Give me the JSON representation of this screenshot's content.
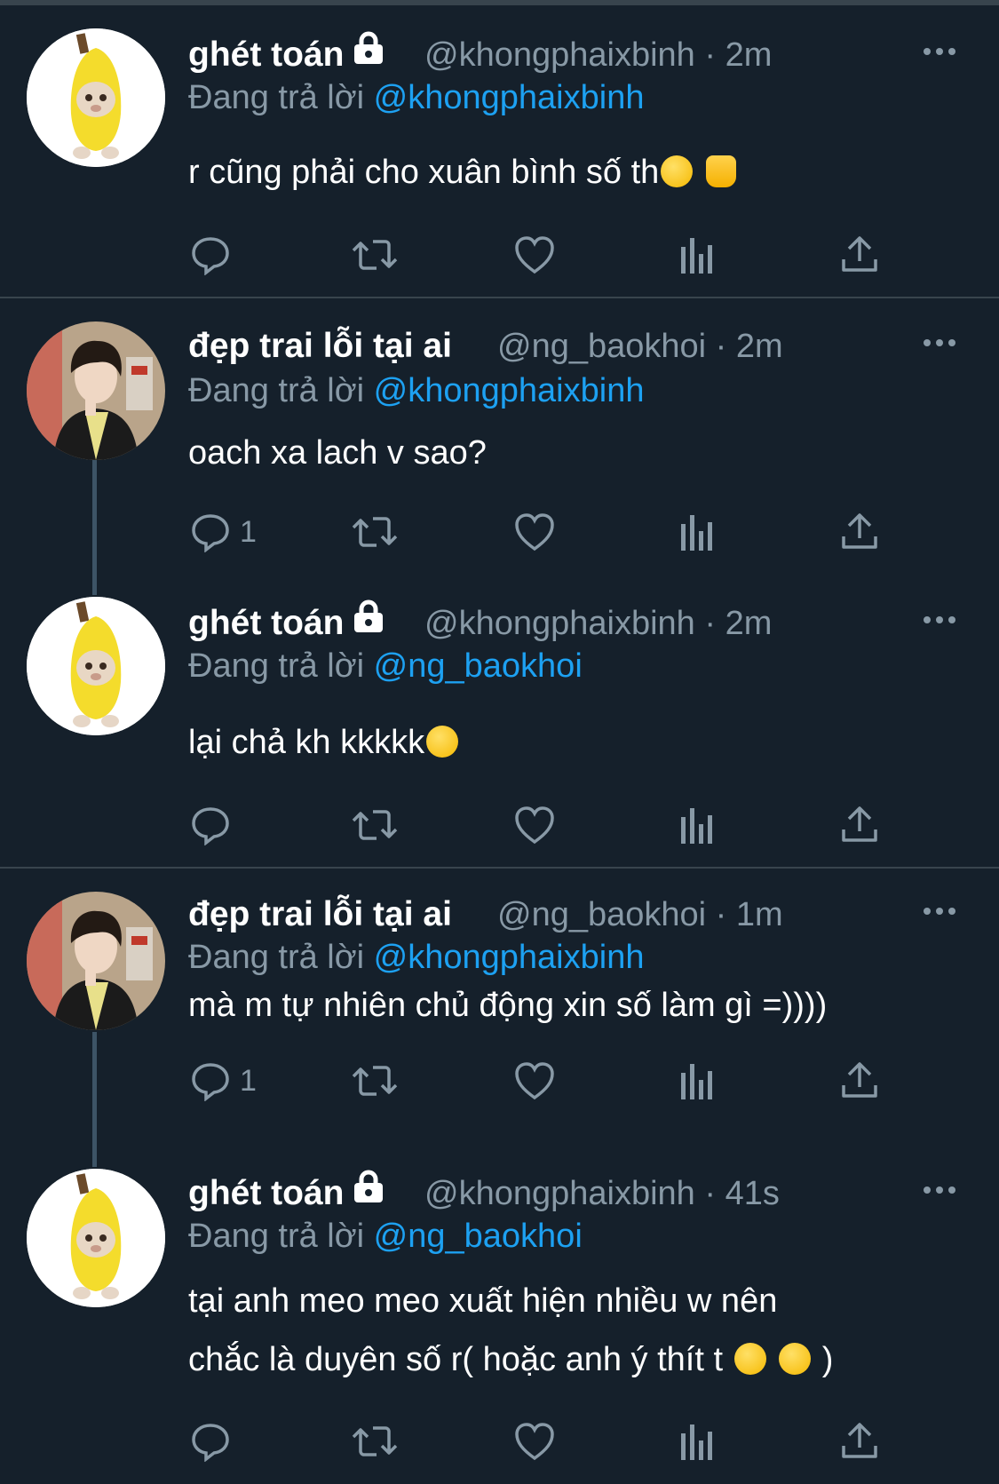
{
  "tweets": [
    {
      "display_name": "ghét toán",
      "locked": true,
      "handle": "@khongphaixbinh",
      "time": "2m",
      "replying_label": "Đang trả lời",
      "replying_to": "@khongphaixbinh",
      "text": "r cũng phải cho xuân bình số th",
      "emojis": [
        "grinning-face-emoji",
        "thumbs-up-emoji"
      ],
      "reply_count": ""
    },
    {
      "display_name": "đẹp trai lỗi tại ai",
      "locked": false,
      "handle": "@ng_baokhoi",
      "time": "2m",
      "replying_label": "Đang trả lời",
      "replying_to": "@khongphaixbinh",
      "text": "oach xa lach v sao?",
      "reply_count": "1"
    },
    {
      "display_name": "ghét toán",
      "locked": true,
      "handle": "@khongphaixbinh",
      "time": "2m",
      "replying_label": "Đang trả lời",
      "replying_to": "@ng_baokhoi",
      "text": "lại chả kh kkkkk",
      "emojis": [
        "grinning-face-emoji"
      ],
      "reply_count": ""
    },
    {
      "display_name": "đẹp trai lỗi tại ai",
      "locked": false,
      "handle": "@ng_baokhoi",
      "time": "1m",
      "replying_label": "Đang trả lời",
      "replying_to": "@khongphaixbinh",
      "text": "mà m tự nhiên chủ động xin số làm gì =))))",
      "reply_count": "1"
    },
    {
      "display_name": "ghét toán",
      "locked": true,
      "handle": "@khongphaixbinh",
      "time": "41s",
      "replying_label": "Đang trả lời",
      "replying_to": "@ng_baokhoi",
      "text_line1": "tại anh meo meo xuất hiện nhiều w nên",
      "text_line2": "chắc là duyên số r( hoặc anh ý thít t",
      "text_line2_end": ")",
      "emojis": [
        "star-struck-emoji",
        "star-struck-emoji"
      ],
      "reply_count": ""
    }
  ],
  "colors": {
    "background": "#15202b",
    "secondary_text": "#8899a6",
    "link": "#1da1f2",
    "divider": "#38444d"
  },
  "icons": [
    "reply-icon",
    "retweet-icon",
    "like-icon",
    "analytics-icon",
    "share-icon",
    "more-icon",
    "lock-icon"
  ]
}
